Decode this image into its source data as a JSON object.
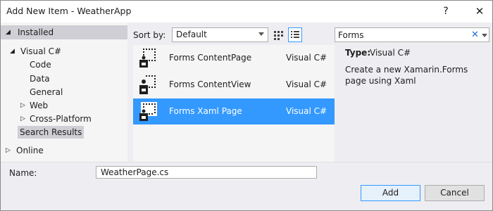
{
  "window": {
    "title": "Add New Item - WeatherApp",
    "help_label": "?",
    "close_label": "✕"
  },
  "tree": {
    "installed": "Installed",
    "visual_csharp": "Visual C#",
    "children": [
      "Code",
      "Data",
      "General"
    ],
    "web": "Web",
    "cross_platform": "Cross-Platform",
    "search_results": "Search Results",
    "online": "Online"
  },
  "toolbar": {
    "sort_label": "Sort by:",
    "sort_value": "Default",
    "search_value": "Forms",
    "search_clear": "✕"
  },
  "templates": [
    {
      "name": "Forms ContentPage",
      "lang": "Visual C#",
      "selected": false
    },
    {
      "name": "Forms ContentView",
      "lang": "Visual C#",
      "selected": false
    },
    {
      "name": "Forms Xaml Page",
      "lang": "Visual C#",
      "selected": true
    }
  ],
  "details": {
    "type_label": "Type:",
    "type_value": "Visual C#",
    "description": "Create a new Xamarin.Forms page using Xaml"
  },
  "footer": {
    "name_label": "Name:",
    "name_value": "WeatherPage.cs",
    "add_label": "Add",
    "cancel_label": "Cancel"
  },
  "colors": {
    "selection": "#3399ff",
    "panel": "#f5f5f5",
    "chrome": "#eeeef2"
  }
}
